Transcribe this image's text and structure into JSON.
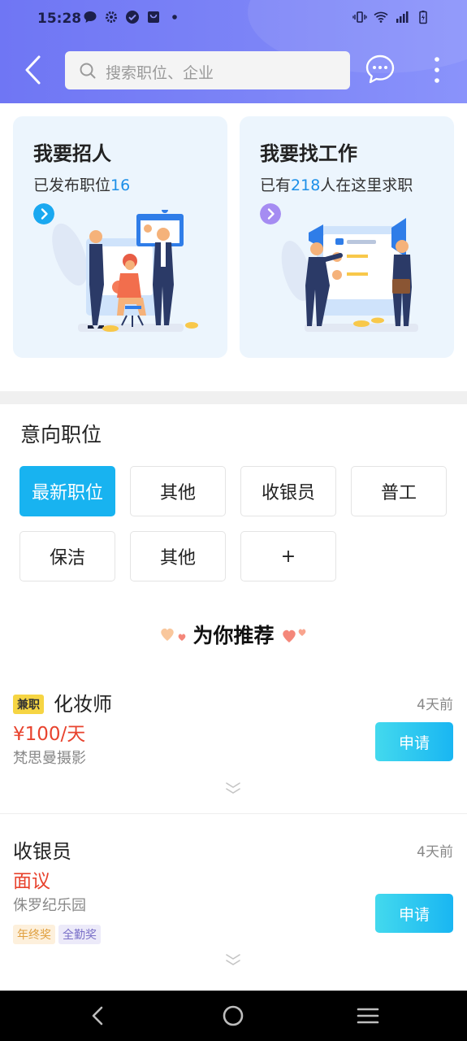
{
  "status_bar": {
    "time": "15:28",
    "left_icons": [
      "message-icon",
      "settings-icon",
      "check-circle-icon",
      "bag-icon",
      "dot-icon"
    ],
    "right_icons": [
      "vibrate-icon",
      "wifi-icon",
      "signal-icon",
      "battery-charging-icon"
    ]
  },
  "header": {
    "search_placeholder": "搜索职位、企业",
    "colors": {
      "gradient_start": "#6f76f4",
      "gradient_end": "#8a93fb"
    }
  },
  "cards": [
    {
      "title": "我要招人",
      "sub_prefix": "已发布职位",
      "sub_number": "16",
      "sub_suffix": "",
      "arrow_color": "#1aa8f0"
    },
    {
      "title": "我要找工作",
      "sub_prefix": "已有",
      "sub_number": "218",
      "sub_suffix": "人在这里求职",
      "arrow_color": "#a58cf2"
    }
  ],
  "intent": {
    "title": "意向职位",
    "tags": [
      "最新职位",
      "其他",
      "收银员",
      "普工",
      "保洁",
      "其他",
      "+"
    ],
    "active_index": 0
  },
  "recommend": {
    "title": "为你推荐"
  },
  "jobs": [
    {
      "type_badge": "兼职",
      "title": "化妆师",
      "salary": "¥100/天",
      "company": "梵思曼摄影",
      "time": "4天前",
      "apply_label": "申请",
      "perks": []
    },
    {
      "type_badge": "",
      "title": "收银员",
      "salary": "面议",
      "company": "侏罗纪乐园",
      "time": "4天前",
      "apply_label": "申请",
      "perks": [
        {
          "label": "年终奖",
          "bg": "#fdf0dc",
          "color": "#e0a040"
        },
        {
          "label": "全勤奖",
          "bg": "#eceaf9",
          "color": "#7a70c8"
        }
      ]
    }
  ],
  "accent": {
    "salary": "#e8432e",
    "active_tag": "#18b3f0",
    "number": "#1c8fe8"
  }
}
